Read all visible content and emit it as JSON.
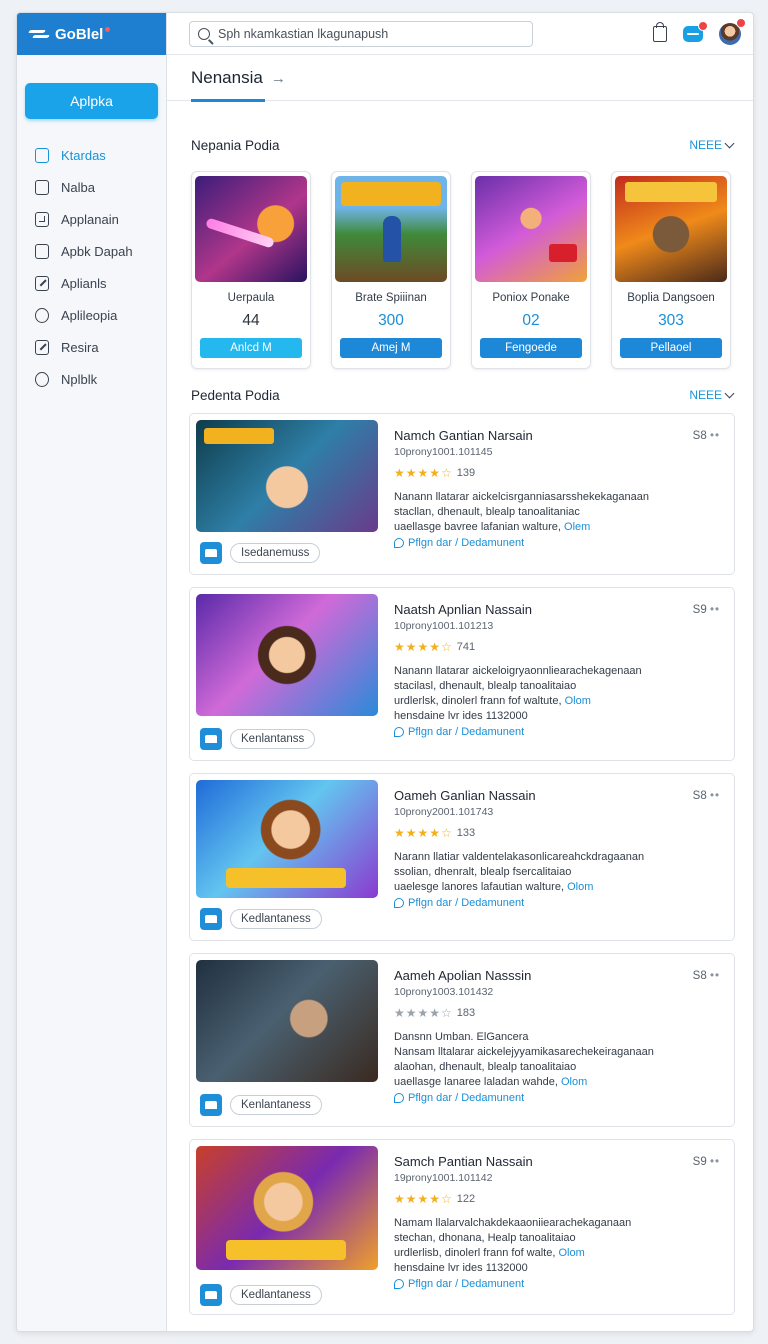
{
  "brand": {
    "name": "GoBlel"
  },
  "sidebar": {
    "primary_label": "Aplpka",
    "items": [
      {
        "label": "Ktardas",
        "icon": "folder-icon",
        "active": true
      },
      {
        "label": "Nalba",
        "icon": "folder-icon",
        "active": false
      },
      {
        "label": "Applanain",
        "icon": "grid-icon",
        "active": false
      },
      {
        "label": "Apbk Dapah",
        "icon": "folder-icon",
        "active": false
      },
      {
        "label": "Aplianls",
        "icon": "edit-icon",
        "active": false
      },
      {
        "label": "Aplileopia",
        "icon": "circle-icon",
        "active": false
      },
      {
        "label": "Resira",
        "icon": "edit-icon",
        "active": false
      },
      {
        "label": "Nplblk",
        "icon": "shield-icon",
        "active": false
      }
    ]
  },
  "search": {
    "value": "Sph nkamkastian lkagunapush"
  },
  "colors": {
    "brand": "#1e7fd0",
    "accent": "#1aa3e8",
    "link": "#1a93d8",
    "star": "#f2b01e"
  },
  "main": {
    "tab_title": "Nenansia",
    "featured": {
      "title": "Nepania Podia",
      "see_more": "NEEE",
      "cards": [
        {
          "name": "Uerpaula",
          "number": "44",
          "button": "Anlcd M",
          "button_color": "#24b8ee"
        },
        {
          "name": "Brate Spiiinan",
          "number": "300",
          "button": "Amej M",
          "button_color": "#1e88d8"
        },
        {
          "name": "Poniox Ponake",
          "number": "02",
          "button": "Fengoede",
          "button_color": "#1e88d8"
        },
        {
          "name": "Boplia Dangsoen",
          "number": "303",
          "button": "Pellaoel",
          "button_color": "#1e88d8"
        }
      ]
    },
    "list": {
      "title": "Pedenta Podia",
      "see_more": "NEEE",
      "items": [
        {
          "title": "Namch Gantian Narsain",
          "subtitle": "10prony1001.101145",
          "stars": 4,
          "rating_count": "139",
          "desc_line1": "Nanann llatarar aickelcisrganniasarsshekekaganaan",
          "desc_line2": "stacllan, dhenault, blealp tanoalitaniac",
          "desc_line3": "uaellasge bavree lafanian walture,",
          "desc_link": "Olem",
          "link": "Pflgn dar / Dedamunent",
          "more": "S8",
          "tag": "Isedanemuss"
        },
        {
          "title": "Naatsh Apnlian Nassain",
          "subtitle": "10prony1001.101213",
          "stars": 4,
          "rating_count": "741",
          "desc_line1": "Nanann llatarar aickeloigryaonnliearachekagenaan",
          "desc_line2": "stacilasl, dhenault, blealp tanoalitaiao",
          "desc_line3": "urdlerlsk, dinolerl frann fof waltute,",
          "desc_link": "Olom",
          "desc_line4": "hensdaine lvr ides 1132000",
          "link": "Pflgn dar / Dedamunent",
          "more": "S9",
          "tag": "Kenlantanss"
        },
        {
          "title": "Oameh Ganlian Nassain",
          "subtitle": "10prony2001.101743",
          "stars": 4,
          "rating_count": "133",
          "desc_line1": "Narann llatiar valdentelakasonlicareahckdragaanan",
          "desc_line2": "ssolian, dhenralt, blealp fsercalitaiao",
          "desc_line3": "uaelesge lanores lafautian walture,",
          "desc_link": "Olom",
          "link": "Pflgn dar / Dedamunent",
          "more": "S8",
          "tag": "Kedlantaness"
        },
        {
          "title": "Aameh Apolian Nasssin",
          "subtitle": "10prony1003.101432",
          "stars": 2,
          "rating_count": "183",
          "extra_line": "Dansnn Umban. ElGancera",
          "desc_line1": "Nansam lltalarar aickelejyyamikasarechekeiraganaan",
          "desc_line2": "alaohan, dhenault, blealp tanoalitaiao",
          "desc_line3": "uaellasge lanaree laladan wahde,",
          "desc_link": "Olom",
          "link": "Pflgn dar / Dedamunent",
          "more": "S8",
          "tag": "Kenlantaness"
        },
        {
          "title": "Samch Pantian Nassain",
          "subtitle": "19prony1001.101142",
          "stars": 4,
          "rating_count": "122",
          "desc_line1": "Namam llalarvalchakdekaaoniiearachekaganaan",
          "desc_line2": "stechan, dhonana, Healp tanoalitaiao",
          "desc_line3": "urdlerlisb, dinolerl frann fof walte,",
          "desc_link": "Olom",
          "desc_line4": "hensdaine lvr ides 1132000",
          "link": "Pflgn dar / Dedamunent",
          "more": "S9",
          "tag": "Kedlantaness"
        }
      ]
    }
  }
}
